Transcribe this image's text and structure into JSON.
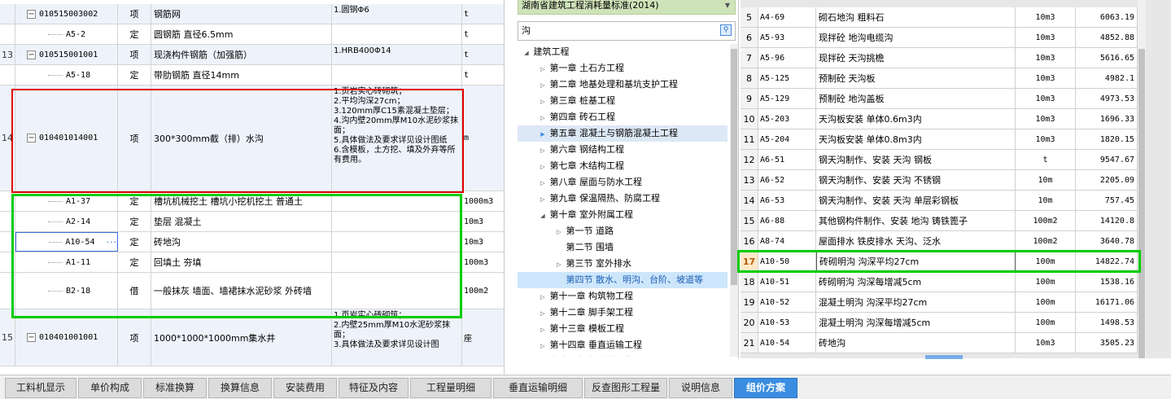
{
  "left_table": {
    "rows": [
      {
        "seq": "",
        "code": "010515003002",
        "type": "项",
        "name": "钢筋网",
        "feature": "1.圆钢Φ6",
        "unit": "t",
        "kind": "parent"
      },
      {
        "seq": "",
        "code": "A5-2",
        "type": "定",
        "name": "圆钢筋 直径6.5mm",
        "feature": "",
        "unit": "t",
        "kind": "sub"
      },
      {
        "seq": "13",
        "code": "010515001001",
        "type": "项",
        "name": "现浇构件钢筋（加强筋）",
        "feature": "1.HRB400Φ14",
        "unit": "t",
        "kind": "parent"
      },
      {
        "seq": "",
        "code": "A5-18",
        "type": "定",
        "name": "带肋钢筋 直径14mm",
        "feature": "",
        "unit": "t",
        "kind": "sub"
      },
      {
        "seq": "14",
        "code": "010401014001",
        "type": "项",
        "name": "300*300mm截（排）水沟",
        "feature": "1.页岩实心砖砌筑；\n2.平均沟深27cm；\n3.120mm厚C15素混凝土垫层；\n4.沟内壁20mm厚M10水泥砂浆抹面；\n5.具体做法及要求详见设计图纸\n6.含模板，土方挖、填及外弃等所有费用。",
        "unit": "m",
        "kind": "parent"
      },
      {
        "seq": "",
        "code": "A1-37",
        "type": "定",
        "name": "槽坑机械挖土 槽坑小挖机挖土 普通土",
        "feature": "",
        "unit": "1000m3",
        "kind": "sub"
      },
      {
        "seq": "",
        "code": "A2-14",
        "type": "定",
        "name": "垫层 混凝土",
        "feature": "",
        "unit": "10m3",
        "kind": "sub"
      },
      {
        "seq": "",
        "code": "A10-54",
        "type": "定",
        "name": "砖地沟",
        "feature": "",
        "unit": "10m3",
        "kind": "sel"
      },
      {
        "seq": "",
        "code": "A1-11",
        "type": "定",
        "name": "回填土 夯填",
        "feature": "",
        "unit": "100m3",
        "kind": "sub"
      },
      {
        "seq": "",
        "code": "B2-18",
        "type": "借",
        "name": "一般抹灰 墙面、墙裙抹水泥砂浆 外砖墙",
        "feature": "",
        "unit": "100m2",
        "kind": "sub"
      },
      {
        "seq": "15",
        "code": "010401001001",
        "type": "项",
        "name": "1000*1000*1000mm集水井",
        "feature": "1.页岩实心砖砌筑；\n2.内壁25mm厚M10水泥砂浆抹面；\n3.具体做法及要求详见设计图",
        "unit": "座",
        "kind": "parent"
      }
    ],
    "more_icon": "ellipsis-icon"
  },
  "mid": {
    "quota_select": "湖南省建筑工程消耗量标准(2014)",
    "search_value": "沟",
    "tree": [
      {
        "label": "建筑工程",
        "level": 0,
        "state": "open"
      },
      {
        "label": "第一章 土石方工程",
        "level": 1,
        "state": "closed"
      },
      {
        "label": "第二章 地基处理和基坑支护工程",
        "level": 1,
        "state": "closed"
      },
      {
        "label": "第三章 桩基工程",
        "level": 1,
        "state": "closed"
      },
      {
        "label": "第四章 砖石工程",
        "level": 1,
        "state": "closed"
      },
      {
        "label": "第五章 混凝土与钢筋混凝土工程",
        "level": 1,
        "state": "closed",
        "hl": true
      },
      {
        "label": "第六章 钢结构工程",
        "level": 1,
        "state": "closed"
      },
      {
        "label": "第七章 木结构工程",
        "level": 1,
        "state": "closed"
      },
      {
        "label": "第八章 屋面与防水工程",
        "level": 1,
        "state": "closed"
      },
      {
        "label": "第九章 保温隔热、防腐工程",
        "level": 1,
        "state": "closed"
      },
      {
        "label": "第十章 室外附属工程",
        "level": 1,
        "state": "open"
      },
      {
        "label": "第一节 道路",
        "level": 2,
        "state": "closed"
      },
      {
        "label": "第二节 围墙",
        "level": 2,
        "state": "none"
      },
      {
        "label": "第三节 室外排水",
        "level": 2,
        "state": "closed"
      },
      {
        "label": "第四节 散水、明沟、台阶、坡道等",
        "level": 2,
        "state": "none",
        "sel": true
      },
      {
        "label": "第十一章 构筑物工程",
        "level": 1,
        "state": "closed"
      },
      {
        "label": "第十二章 脚手架工程",
        "level": 1,
        "state": "closed"
      },
      {
        "label": "第十三章 模板工程",
        "level": 1,
        "state": "closed"
      },
      {
        "label": "第十四章 垂直运输工程",
        "level": 1,
        "state": "closed"
      },
      {
        "label": "第十五章 超高增加费",
        "level": 1,
        "state": "closed"
      }
    ]
  },
  "right_table": {
    "rows": [
      {
        "n": "5",
        "code": "A4-69",
        "name": "砌石地沟 粗料石",
        "unit": "10m3",
        "price": "6063.19"
      },
      {
        "n": "6",
        "code": "A5-93",
        "name": "现拌砼 地沟电缆沟",
        "unit": "10m3",
        "price": "4852.88"
      },
      {
        "n": "7",
        "code": "A5-96",
        "name": "现拌砼 天沟挑檐",
        "unit": "10m3",
        "price": "5616.65"
      },
      {
        "n": "8",
        "code": "A5-125",
        "name": "预制砼 天沟板",
        "unit": "10m3",
        "price": "4982.1"
      },
      {
        "n": "9",
        "code": "A5-129",
        "name": "预制砼 地沟盖板",
        "unit": "10m3",
        "price": "4973.53"
      },
      {
        "n": "10",
        "code": "A5-203",
        "name": "天沟板安装 单体0.6m3内",
        "unit": "10m3",
        "price": "1696.33"
      },
      {
        "n": "11",
        "code": "A5-204",
        "name": "天沟板安装 单体0.8m3内",
        "unit": "10m3",
        "price": "1820.15"
      },
      {
        "n": "12",
        "code": "A6-51",
        "name": "钢天沟制作、安装 天沟 钢板",
        "unit": "t",
        "price": "9547.67"
      },
      {
        "n": "13",
        "code": "A6-52",
        "name": "钢天沟制作、安装 天沟 不锈钢",
        "unit": "10m",
        "price": "2205.09"
      },
      {
        "n": "14",
        "code": "A6-53",
        "name": "钢天沟制作、安装 天沟 单层彩钢板",
        "unit": "10m",
        "price": "757.45"
      },
      {
        "n": "15",
        "code": "A6-88",
        "name": "其他钢构件制作、安装 地沟 铸铁篦子",
        "unit": "100m2",
        "price": "14120.8"
      },
      {
        "n": "16",
        "code": "A8-74",
        "name": "屋面排水 铁皮排水 天沟、泛水",
        "unit": "100m2",
        "price": "3640.78"
      },
      {
        "n": "17",
        "code": "A10-50",
        "name": "砖砌明沟 沟深平均27cm",
        "unit": "100m",
        "price": "14822.74",
        "sel": true
      },
      {
        "n": "18",
        "code": "A10-51",
        "name": "砖砌明沟 沟深每增减5cm",
        "unit": "100m",
        "price": "1538.16"
      },
      {
        "n": "19",
        "code": "A10-52",
        "name": "混凝土明沟 沟深平均27cm",
        "unit": "100m",
        "price": "16171.06"
      },
      {
        "n": "20",
        "code": "A10-53",
        "name": "混凝土明沟 沟深每增减5cm",
        "unit": "100m",
        "price": "1498.53"
      },
      {
        "n": "21",
        "code": "A10-54",
        "name": "砖地沟",
        "unit": "10m3",
        "price": "3505.23"
      }
    ]
  },
  "bottom_tabs": [
    {
      "label": "工料机显示"
    },
    {
      "label": "单价构成"
    },
    {
      "label": "标准换算"
    },
    {
      "label": "换算信息"
    },
    {
      "label": "安装费用"
    },
    {
      "label": "特征及内容"
    },
    {
      "label": "工程量明细"
    },
    {
      "label": "垂直运输明细"
    },
    {
      "label": "反查图形工程量"
    },
    {
      "label": "说明信息"
    },
    {
      "label": "组价方案",
      "active": true
    }
  ],
  "colors": {
    "highlight_red": "#e00000",
    "highlight_green": "#00cc00",
    "active_tab": "#3a8de1",
    "combo_bg": "#cfe3b9"
  }
}
